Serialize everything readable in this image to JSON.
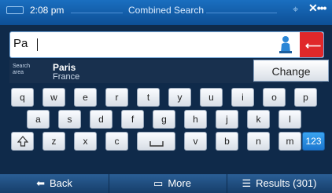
{
  "status": {
    "time": "2:08 pm",
    "title": "Combined Search"
  },
  "search": {
    "value": "Pa"
  },
  "search_area": {
    "label": "Search area",
    "city": "Paris",
    "country": "France",
    "change_label": "Change"
  },
  "keyboard": {
    "row1": [
      "q",
      "w",
      "e",
      "r",
      "t",
      "y",
      "u",
      "i",
      "o",
      "p"
    ],
    "row2": [
      "a",
      "s",
      "d",
      "f",
      "g",
      "h",
      "j",
      "k",
      "l"
    ],
    "row3": [
      "z",
      "x",
      "c",
      "v",
      "b",
      "n",
      "m"
    ],
    "shift_icon": "shift-up-arrow",
    "space_icon": "space-bracket",
    "numbers_label": "123"
  },
  "bottom": {
    "back_label": "Back",
    "more_label": "More",
    "results_label": "Results (301)"
  }
}
